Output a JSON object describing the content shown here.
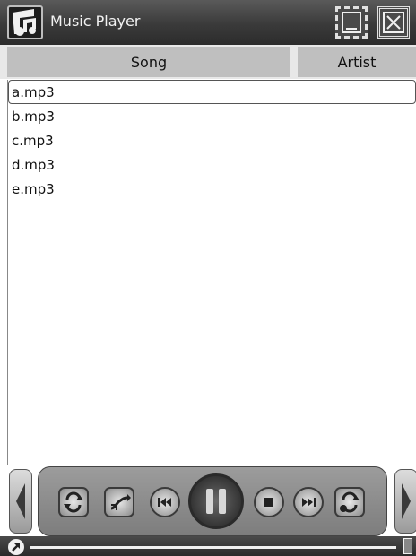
{
  "window": {
    "title": "Music Player"
  },
  "columns": {
    "song": "Song",
    "artist": "Artist"
  },
  "songs": [
    "a.mp3",
    "b.mp3",
    "c.mp3",
    "d.mp3",
    "e.mp3"
  ],
  "selected_song_index": 0,
  "player": {
    "state": "playing"
  },
  "icons": {
    "app": "music-player-logo-icon",
    "minimize": "minimize-icon",
    "close": "close-icon",
    "repeat": "repeat-icon",
    "shuffle": "shuffle-icon",
    "previous": "previous-track-icon",
    "pause": "pause-icon",
    "stop": "stop-icon",
    "next": "next-track-icon",
    "repeat_one": "repeat-one-icon",
    "status": "arrow-up-right-icon",
    "battery": "battery-icon"
  }
}
